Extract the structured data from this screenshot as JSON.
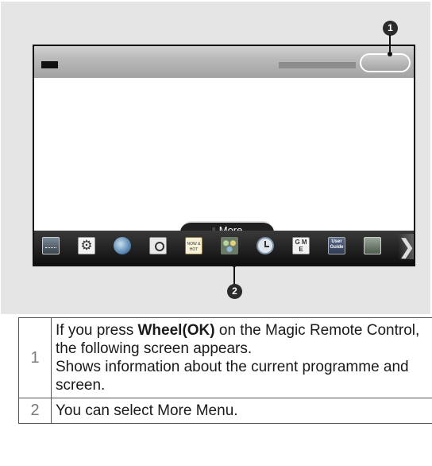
{
  "callouts": [
    "1",
    "2"
  ],
  "screen": {
    "more_tab_label": "More",
    "more_grip": "⠿",
    "menu_icons": [
      {
        "icon": "input-list-icon"
      },
      {
        "icon": "settings-icon",
        "glyph": "⚙"
      },
      {
        "icon": "internet-icon"
      },
      {
        "icon": "search-icon"
      },
      {
        "icon": "now-and-hot-icon",
        "text": "NOW & HOT"
      },
      {
        "icon": "more-apps-icon"
      },
      {
        "icon": "clock-icon"
      },
      {
        "icon": "game-world-icon",
        "text": "G M E"
      },
      {
        "icon": "user-guide-icon",
        "text": "User Guide"
      },
      {
        "icon": "manual-icon"
      },
      {
        "icon": "scroll-right-icon",
        "glyph": "❯"
      }
    ]
  },
  "table": {
    "rows": [
      {
        "num": "1",
        "line1_before": "If you press ",
        "line1_bold": "Wheel(OK)",
        "line1_after": " on the Magic Remote Control, the following screen appears.",
        "line2": "Shows information about the current programme and screen."
      },
      {
        "num": "2",
        "text": "You can select More Menu."
      }
    ]
  },
  "colors": {
    "panel": "#e5e5e5",
    "menu_bar": "#0e0e0e",
    "callout": "#2b2b2b"
  }
}
